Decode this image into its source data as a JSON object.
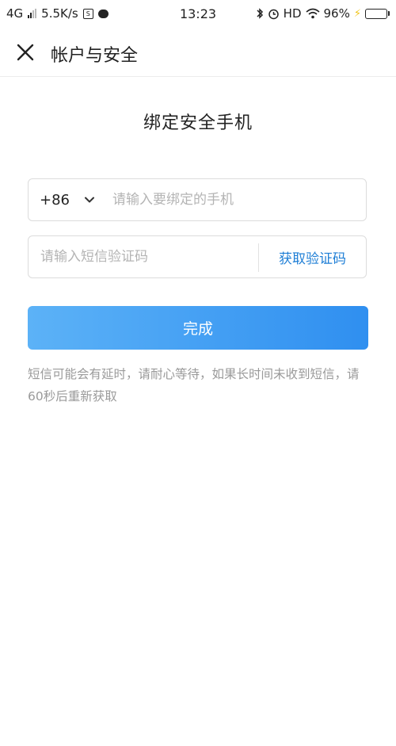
{
  "status_bar": {
    "network": "4G",
    "speed": "5.5K/s",
    "time": "13:23",
    "hd": "HD",
    "battery_percent": "96%",
    "battery_level": 0.96,
    "icons": [
      "signal-icon",
      "screen-record-icon",
      "message-icon",
      "bluetooth-icon",
      "alarm-icon",
      "wifi-icon",
      "charging-icon",
      "battery-icon"
    ]
  },
  "nav": {
    "title": "帐户与安全",
    "close_icon": "close-icon"
  },
  "page": {
    "heading": "绑定安全手机"
  },
  "phone_field": {
    "country_code": "+86",
    "placeholder": "请输入要绑定的手机",
    "value": ""
  },
  "code_field": {
    "placeholder": "请输入短信验证码",
    "value": "",
    "get_code_label": "获取验证码"
  },
  "submit": {
    "label": "完成"
  },
  "hint": {
    "text": "短信可能会有延时，请耐心等待，如果长时间未收到短信，请60秒后重新获取"
  },
  "colors": {
    "accent": "#1f7fd6",
    "button_start": "#5cb2f7",
    "button_end": "#2f8ff0",
    "hint": "#9a9a9a"
  }
}
